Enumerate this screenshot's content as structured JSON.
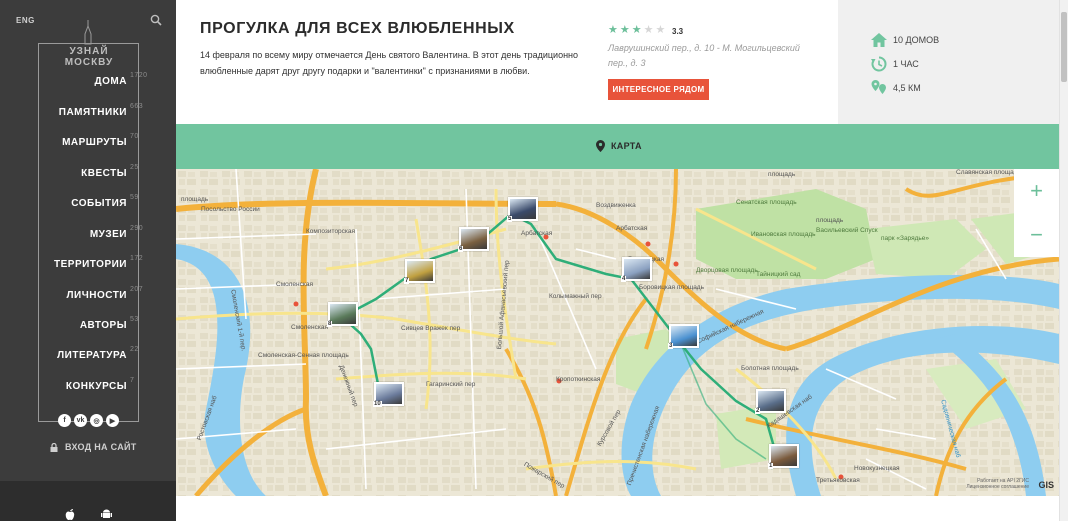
{
  "sidebar": {
    "lang": "ENG",
    "logo_text": "УЗНАЙ МОСКВУ",
    "menu": [
      {
        "label": "ДОМА",
        "count": "1720"
      },
      {
        "label": "ПАМЯТНИКИ",
        "count": "663"
      },
      {
        "label": "МАРШРУТЫ",
        "count": "70"
      },
      {
        "label": "КВЕСТЫ",
        "count": "25"
      },
      {
        "label": "СОБЫТИЯ",
        "count": "59"
      },
      {
        "label": "МУЗЕИ",
        "count": "290"
      },
      {
        "label": "ТЕРРИТОРИИ",
        "count": "172"
      },
      {
        "label": "ЛИЧНОСТИ",
        "count": "207"
      },
      {
        "label": "АВТОРЫ",
        "count": "53"
      },
      {
        "label": "ЛИТЕРАТУРА",
        "count": "22"
      },
      {
        "label": "КОНКУРСЫ",
        "count": "7"
      }
    ],
    "socials": [
      "f",
      "vk",
      "ig",
      "yt"
    ],
    "login_label": "ВХОД НА САЙТ"
  },
  "header": {
    "title": "ПРОГУЛКА ДЛЯ ВСЕХ ВЛЮБЛЕННЫХ",
    "description": "14 февраля по всему миру отмечается День святого Валентина. В этот день традиционно влюбленные дарят друг другу подарки и \"валентинки\" с признаниями в любви.",
    "rating_value": "3.3",
    "rating_stars": 3,
    "rating_max": 5,
    "address": "Лаврушинский пер., д. 10 - М. Могильцевский пер., д. 3",
    "nearby_button": "ИНТЕРЕСНОЕ РЯДОМ"
  },
  "stats": {
    "houses": "10 ДОМОВ",
    "duration": "1 ЧАС",
    "distance": "4,5 КМ"
  },
  "mapbar": {
    "label": "КАРТА"
  },
  "map": {
    "zoom_in": "+",
    "zoom_out": "−",
    "places": {
      "kompozitorskaya": "Композиторская",
      "smolenskaya1": "Смоленская",
      "smolenskaya2": "Смоленская",
      "smolensky_lane": "Смоленский 1-й пер.",
      "smolenskaya_sennaya": "Смоленская-Сенная площадь",
      "sivtsev": "Сивцев Вражек пер",
      "gagarinsky": "Гагаринский пер",
      "denezhny": "Денежный пер",
      "kolymazhny": "Колымажный пер",
      "bolshoy_afanasyevsky": "Большой Афанасьевский пер",
      "arbatskaya": "Арбатская",
      "arbatskaya2": "Арбатская",
      "vozdvizhenka": "Воздвиженка",
      "borovitskaya": "Боровицкая",
      "borovitskaya_sq": "Боровицкая площадь",
      "kropotkinskaya": "Кропоткинская",
      "prechistenskaya": "Пречистенская набережная",
      "berezhkovskaya": "Берсеневская набережная",
      "sofiyskaya": "Софийская набережная",
      "bolotnaya": "Болотная площадь",
      "senatskaya": "Сенатская площадь",
      "ivanovskaya": "Ивановская площадь",
      "vasilyevsky": "Васильевский Спуск",
      "dvortsovaya": "Дворцовая площадь",
      "tainitsky": "Тайницкий сад",
      "zaryadye": "парк «Зарядье»",
      "novokuznetskaya": "Новокузнецкая",
      "tretyakovskaya": "Третьяковская",
      "kadashevskaya": "Кадашевская наб",
      "slavyanskaya": "Славянская площадь",
      "sadovnicheskaya": "Садовническая наб",
      "pozharsky": "Пожарский пер",
      "ostozhenka": "Остоженка",
      "kursovoy": "Курсовой пер",
      "prechistenka": "Пречистенка",
      "rostovskaya": "Ростовская наб",
      "ploshchad1": "площадь",
      "ploshchad2": "площадь",
      "ploshchad3": "площадь",
      "ruska": "Посольство России"
    },
    "pins": [
      {
        "num": "1",
        "color": "#7a5a3c"
      },
      {
        "num": "2",
        "color": "#5a6e8a"
      },
      {
        "num": "3",
        "color": "#4a90d0"
      },
      {
        "num": "4",
        "color": "#8aa0c0"
      },
      {
        "num": "5",
        "color": "#3a4a6a"
      },
      {
        "num": "6",
        "color": "#7a6040"
      },
      {
        "num": "7",
        "color": "#c0a040"
      },
      {
        "num": "8",
        "color": "#5a7a5a"
      },
      {
        "num": "10",
        "color": "#6a7a9a"
      }
    ],
    "copyright_line1": "Работает на API 2ГИС",
    "copyright_line2": "Лицензионное соглашение",
    "gis_label": "GIS"
  }
}
